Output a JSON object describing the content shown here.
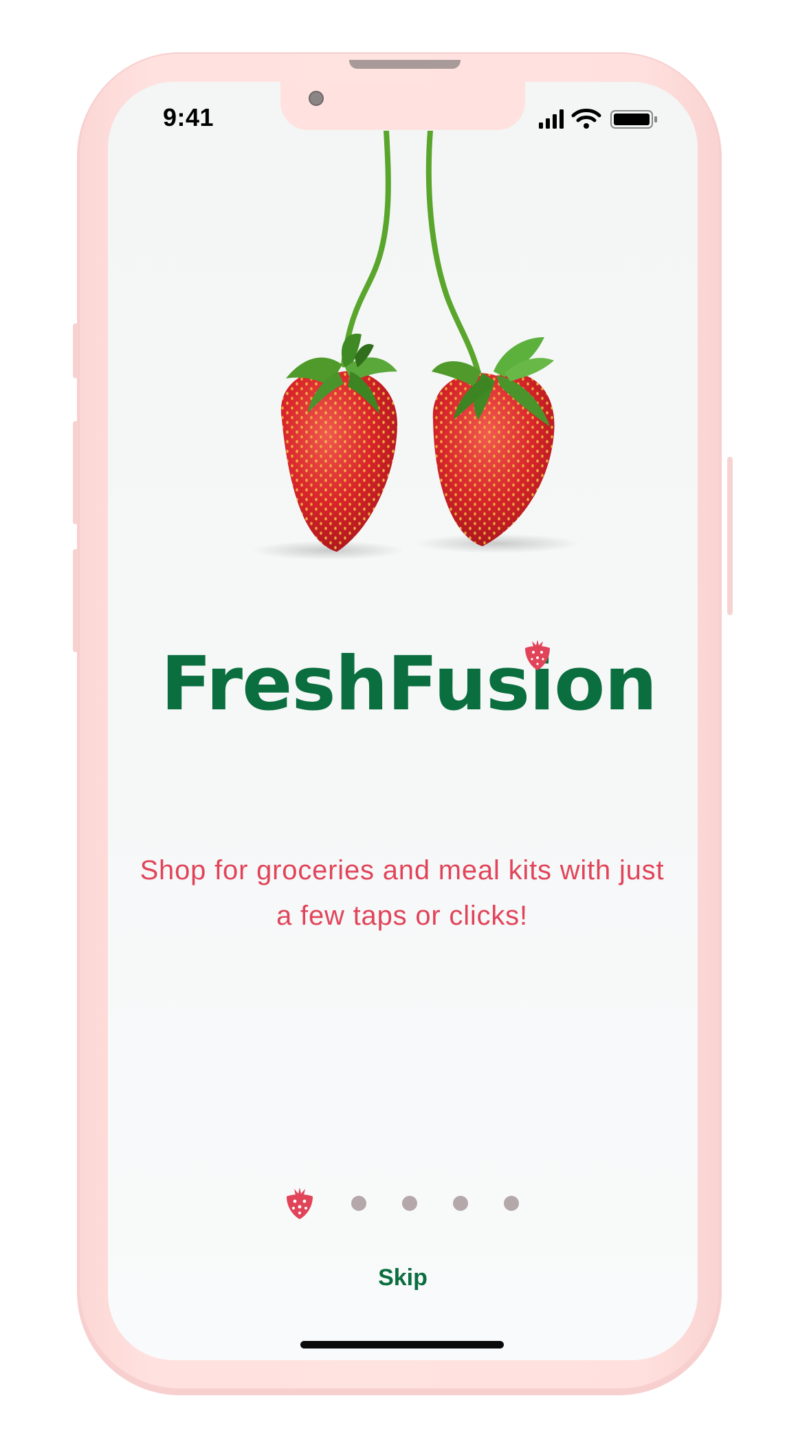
{
  "status_bar": {
    "time": "9:41",
    "icons": [
      "signal-icon",
      "wifi-icon",
      "battery-icon"
    ]
  },
  "brand": {
    "name": "FreshFusion",
    "logo_icon": "strawberry-icon",
    "colors": {
      "primary_green": "#0b6e3f",
      "accent_red": "#e14459",
      "phone_frame": "#ffe2e0"
    }
  },
  "hero": {
    "illustration": "strawberries-image"
  },
  "onboarding": {
    "tagline": "Shop for groceries and meal kits with just a few taps or clicks!",
    "pages_total": 5,
    "current_page": 1,
    "active_indicator_icon": "strawberry-icon",
    "skip_label": "Skip"
  }
}
